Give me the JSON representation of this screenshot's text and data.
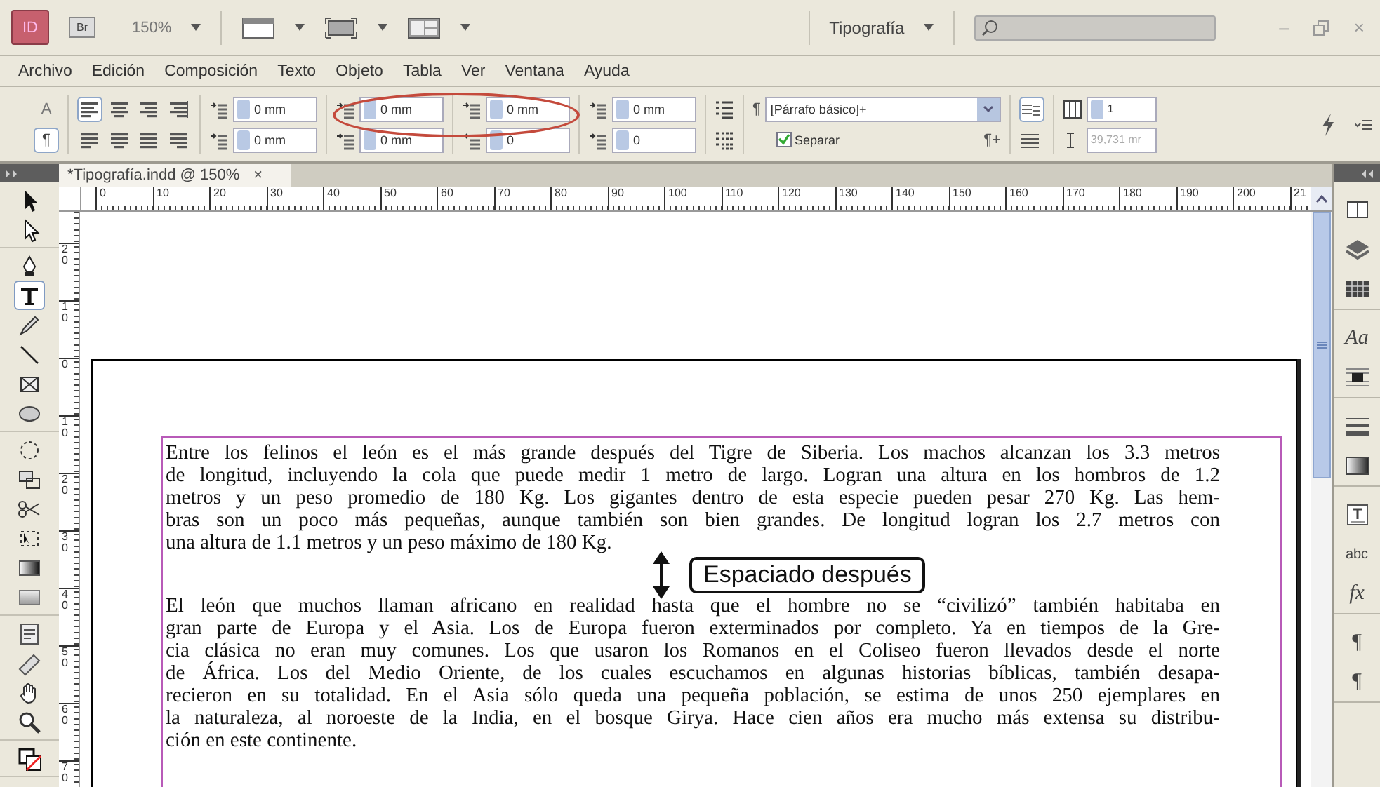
{
  "app_bar": {
    "app_badge": "ID",
    "bridge_badge": "Br",
    "zoom": "150%",
    "workspace": "Tipografía",
    "window_buttons": [
      {
        "kind": "minimize",
        "label": "–"
      },
      {
        "kind": "restore"
      },
      {
        "kind": "close",
        "label": "×"
      }
    ]
  },
  "menu": [
    "Archivo",
    "Edición",
    "Composición",
    "Texto",
    "Objeto",
    "Tabla",
    "Ver",
    "Ventana",
    "Ayuda"
  ],
  "control_panel": {
    "modes": [
      {
        "label": "A",
        "selected": false
      },
      {
        "label": "¶",
        "selected": true
      }
    ],
    "alignment": [
      {
        "kind": "left",
        "selected": true
      },
      {
        "kind": "center",
        "selected": false
      },
      {
        "kind": "right",
        "selected": false
      },
      {
        "kind": "spine",
        "selected": false
      },
      {
        "kind": "justify-left",
        "selected": false
      },
      {
        "kind": "justify-center",
        "selected": false
      },
      {
        "kind": "justify-all",
        "selected": false
      },
      {
        "kind": "justify-right",
        "selected": false
      }
    ],
    "field_columns": [
      [
        {
          "value": "0 mm"
        },
        {
          "value": "0 mm"
        }
      ],
      [
        {
          "value": "0 mm"
        },
        {
          "value": "0 mm"
        }
      ],
      [
        {
          "value": "0 mm"
        },
        {
          "value": "0"
        }
      ],
      [
        {
          "value": "0 mm"
        },
        {
          "value": "0"
        }
      ]
    ],
    "style_mark": "¶",
    "paragraph_style": "[Párrafo básico]+",
    "hyphenate": {
      "label": "Separar",
      "checked": true
    },
    "clear_mark": "¶+",
    "columns": "1",
    "column_width": "39,731 mr"
  },
  "document_tab": {
    "title": "*Tipografía.indd @ 150%",
    "close": "×"
  },
  "rulers": {
    "horizontal": [
      "0",
      "10",
      "20",
      "30",
      "40",
      "50",
      "60",
      "70",
      "80",
      "90",
      "100",
      "110",
      "120",
      "130",
      "140",
      "150",
      "160",
      "170",
      "180",
      "190",
      "200",
      "21"
    ],
    "vertical": [
      "20",
      "10",
      "0",
      "10",
      "20",
      "30",
      "40",
      "50",
      "60",
      "70"
    ]
  },
  "tools": [
    [
      {
        "kind": "selection",
        "selected": false
      },
      {
        "kind": "direct-selection",
        "selected": false
      }
    ],
    [
      {
        "kind": "pen",
        "selected": false
      },
      {
        "kind": "type",
        "selected": true
      },
      {
        "kind": "pencil",
        "selected": false
      },
      {
        "kind": "line",
        "selected": false
      },
      {
        "kind": "rectangle-frame",
        "selected": false
      },
      {
        "kind": "ellipse",
        "selected": false
      }
    ],
    [
      {
        "kind": "rotate",
        "selected": false
      },
      {
        "kind": "scale",
        "selected": false
      },
      {
        "kind": "scissors",
        "selected": false
      },
      {
        "kind": "free-transform",
        "selected": false
      },
      {
        "kind": "gradient",
        "selected": false
      },
      {
        "kind": "gradient-feather",
        "selected": false
      }
    ],
    [
      {
        "kind": "note",
        "selected": false
      },
      {
        "kind": "measure",
        "selected": false
      },
      {
        "kind": "hand",
        "selected": false
      },
      {
        "kind": "zoom",
        "selected": false
      }
    ],
    [
      {
        "kind": "fill-stroke",
        "selected": false
      }
    ]
  ],
  "dock": [
    [
      {
        "kind": "pages"
      },
      {
        "kind": "layers"
      },
      {
        "kind": "swatches"
      }
    ],
    [
      {
        "kind": "glyph",
        "label": "Aa"
      },
      {
        "kind": "text-wrap"
      }
    ],
    [
      {
        "kind": "stroke"
      },
      {
        "kind": "gradient"
      }
    ],
    [
      {
        "kind": "text-frame"
      },
      {
        "kind": "glyph",
        "label": "abc"
      },
      {
        "kind": "glyph",
        "label": "fx"
      }
    ],
    [
      {
        "kind": "glyph",
        "label": "¶"
      },
      {
        "kind": "glyph",
        "label": "¶"
      }
    ]
  ],
  "paragraphs": [
    {
      "lines": [
        "Entre los felinos el león es el más grande después del Tigre de Siberia. Los machos alcanzan los 3.3 metros",
        "de longitud, incluyendo la cola que puede medir 1 metro de largo. Logran una altura en los hombros de 1.2",
        "metros y un peso promedio de 180 Kg. Los gigantes dentro de esta especie pueden pesar 270 Kg. Las hem-",
        "bras son un poco más pequeñas, aunque también son bien grandes. De longitud logran los 2.7 metros con",
        "una altura de 1.1 metros y un peso máximo de 180 Kg."
      ]
    },
    {
      "lines": [
        "El león que muchos llaman africano en realidad hasta que el hombre no se “civilizó” también habitaba en",
        "gran parte de Europa y el Asia. Los de Europa fueron exterminados por completo. Ya en tiempos de la Gre-",
        "cia clásica no eran muy comunes. Los que usaron los Romanos en el Coliseo fueron llevados desde el norte",
        "de África. Los del Medio Oriente, de los cuales escuchamos en algunas historias bíblicas, también desapa-",
        "recieron en su totalidad. En el Asia sólo queda una pequeña población, se estima de unos 250 ejemplares en",
        "la naturaleza, al noroeste de la India, en el bosque Girya. Hace cien años era mucho más extensa su distribu-",
        "ción en este continente."
      ]
    }
  ],
  "callout": "Espaciado después"
}
